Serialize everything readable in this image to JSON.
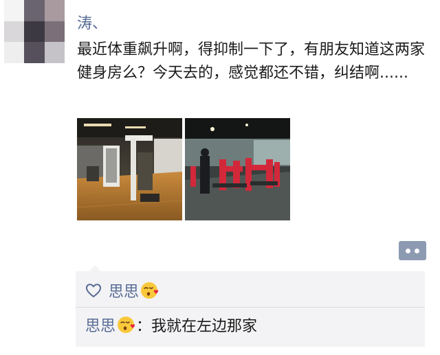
{
  "post": {
    "username": "涛、",
    "text": "最近体重飙升啊，得抑制一下了，有朋友知道这两家健身房么？今天去的，感觉都还不错，纠结啊......",
    "photos": [
      {
        "icon": "gym-photo-wooden-floor"
      },
      {
        "icon": "gym-photo-red-machines"
      }
    ]
  },
  "actions": {
    "comment_icon": "more-dots-icon"
  },
  "likes": {
    "icon": "heart-outline-icon",
    "names": [
      "思思"
    ],
    "emoji": "kissing-heart-emoji"
  },
  "comments": [
    {
      "author": "思思",
      "emoji": "kissing-heart-emoji",
      "separator": "：",
      "text": "我就在左边那家"
    }
  ],
  "colors": {
    "link": "#576b95",
    "panel_bg": "#f3f3f5",
    "button_bg": "#8c9bb2"
  }
}
